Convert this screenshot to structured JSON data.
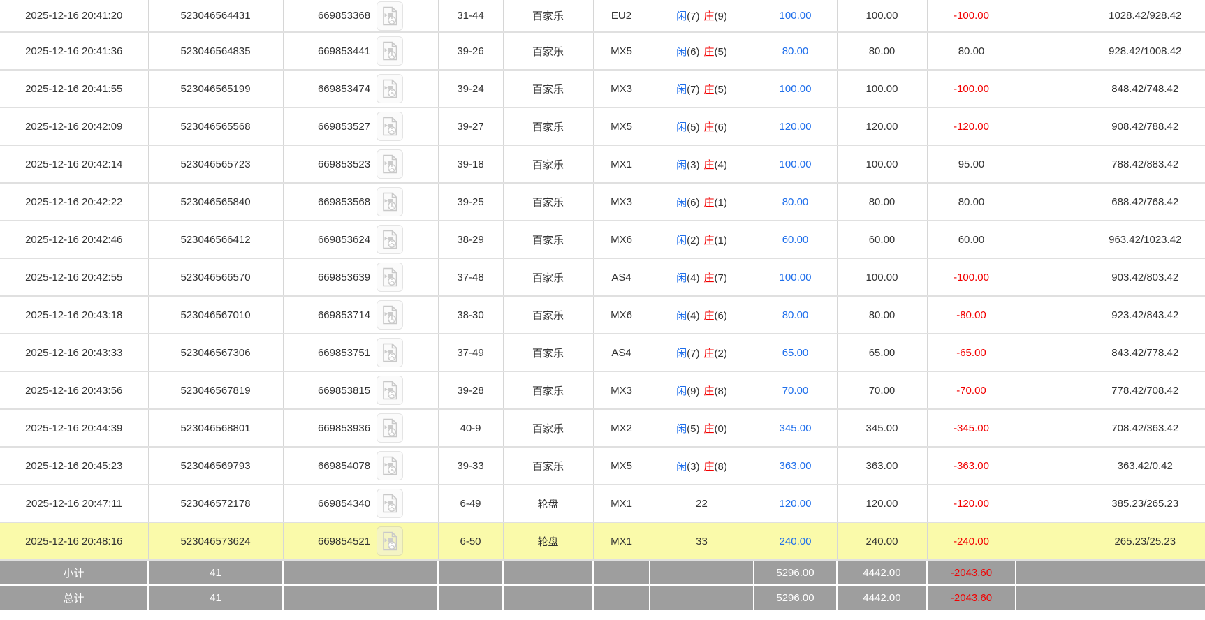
{
  "colors": {
    "bet_link_blue": "#1e6eeb",
    "player_blue": "#1e6eeb",
    "banker_red": "#f20000",
    "loss_red": "#f20000",
    "highlight_yellow": "#fafaaa",
    "summary_gray_bg": "#9e9e9e",
    "body_text": "#333333",
    "summary_text": "#ffffff"
  },
  "icons": {
    "video_replay": "video-replay-icon"
  },
  "table": {
    "rows": [
      {
        "time": "2025-12-16 20:41:20",
        "serial": "523046564431",
        "round": "669853368",
        "shoe": "31-44",
        "game": "百家乐",
        "table_code": "EU2",
        "result": {
          "kind": "baccarat",
          "player_label": "闲",
          "player_score": "(7)",
          "banker_label": "庄",
          "banker_score": "(9)"
        },
        "bet": "100.00",
        "valid": "100.00",
        "win_loss": "-100.00",
        "balance": "1028.42/928.42",
        "highlight": false
      },
      {
        "time": "2025-12-16 20:41:36",
        "serial": "523046564835",
        "round": "669853441",
        "shoe": "39-26",
        "game": "百家乐",
        "table_code": "MX5",
        "result": {
          "kind": "baccarat",
          "player_label": "闲",
          "player_score": "(6)",
          "banker_label": "庄",
          "banker_score": "(5)"
        },
        "bet": "80.00",
        "valid": "80.00",
        "win_loss": "80.00",
        "balance": "928.42/1008.42",
        "highlight": false
      },
      {
        "time": "2025-12-16 20:41:55",
        "serial": "523046565199",
        "round": "669853474",
        "shoe": "39-24",
        "game": "百家乐",
        "table_code": "MX3",
        "result": {
          "kind": "baccarat",
          "player_label": "闲",
          "player_score": "(7)",
          "banker_label": "庄",
          "banker_score": "(5)"
        },
        "bet": "100.00",
        "valid": "100.00",
        "win_loss": "-100.00",
        "balance": "848.42/748.42",
        "highlight": false
      },
      {
        "time": "2025-12-16 20:42:09",
        "serial": "523046565568",
        "round": "669853527",
        "shoe": "39-27",
        "game": "百家乐",
        "table_code": "MX5",
        "result": {
          "kind": "baccarat",
          "player_label": "闲",
          "player_score": "(5)",
          "banker_label": "庄",
          "banker_score": "(6)"
        },
        "bet": "120.00",
        "valid": "120.00",
        "win_loss": "-120.00",
        "balance": "908.42/788.42",
        "highlight": false
      },
      {
        "time": "2025-12-16 20:42:14",
        "serial": "523046565723",
        "round": "669853523",
        "shoe": "39-18",
        "game": "百家乐",
        "table_code": "MX1",
        "result": {
          "kind": "baccarat",
          "player_label": "闲",
          "player_score": "(3)",
          "banker_label": "庄",
          "banker_score": "(4)"
        },
        "bet": "100.00",
        "valid": "100.00",
        "win_loss": "95.00",
        "balance": "788.42/883.42",
        "highlight": false
      },
      {
        "time": "2025-12-16 20:42:22",
        "serial": "523046565840",
        "round": "669853568",
        "shoe": "39-25",
        "game": "百家乐",
        "table_code": "MX3",
        "result": {
          "kind": "baccarat",
          "player_label": "闲",
          "player_score": "(6)",
          "banker_label": "庄",
          "banker_score": "(1)"
        },
        "bet": "80.00",
        "valid": "80.00",
        "win_loss": "80.00",
        "balance": "688.42/768.42",
        "highlight": false
      },
      {
        "time": "2025-12-16 20:42:46",
        "serial": "523046566412",
        "round": "669853624",
        "shoe": "38-29",
        "game": "百家乐",
        "table_code": "MX6",
        "result": {
          "kind": "baccarat",
          "player_label": "闲",
          "player_score": "(2)",
          "banker_label": "庄",
          "banker_score": "(1)"
        },
        "bet": "60.00",
        "valid": "60.00",
        "win_loss": "60.00",
        "balance": "963.42/1023.42",
        "highlight": false
      },
      {
        "time": "2025-12-16 20:42:55",
        "serial": "523046566570",
        "round": "669853639",
        "shoe": "37-48",
        "game": "百家乐",
        "table_code": "AS4",
        "result": {
          "kind": "baccarat",
          "player_label": "闲",
          "player_score": "(4)",
          "banker_label": "庄",
          "banker_score": "(7)"
        },
        "bet": "100.00",
        "valid": "100.00",
        "win_loss": "-100.00",
        "balance": "903.42/803.42",
        "highlight": false
      },
      {
        "time": "2025-12-16 20:43:18",
        "serial": "523046567010",
        "round": "669853714",
        "shoe": "38-30",
        "game": "百家乐",
        "table_code": "MX6",
        "result": {
          "kind": "baccarat",
          "player_label": "闲",
          "player_score": "(4)",
          "banker_label": "庄",
          "banker_score": "(6)"
        },
        "bet": "80.00",
        "valid": "80.00",
        "win_loss": "-80.00",
        "balance": "923.42/843.42",
        "highlight": false
      },
      {
        "time": "2025-12-16 20:43:33",
        "serial": "523046567306",
        "round": "669853751",
        "shoe": "37-49",
        "game": "百家乐",
        "table_code": "AS4",
        "result": {
          "kind": "baccarat",
          "player_label": "闲",
          "player_score": "(7)",
          "banker_label": "庄",
          "banker_score": "(2)"
        },
        "bet": "65.00",
        "valid": "65.00",
        "win_loss": "-65.00",
        "balance": "843.42/778.42",
        "highlight": false
      },
      {
        "time": "2025-12-16 20:43:56",
        "serial": "523046567819",
        "round": "669853815",
        "shoe": "39-28",
        "game": "百家乐",
        "table_code": "MX3",
        "result": {
          "kind": "baccarat",
          "player_label": "闲",
          "player_score": "(9)",
          "banker_label": "庄",
          "banker_score": "(8)"
        },
        "bet": "70.00",
        "valid": "70.00",
        "win_loss": "-70.00",
        "balance": "778.42/708.42",
        "highlight": false
      },
      {
        "time": "2025-12-16 20:44:39",
        "serial": "523046568801",
        "round": "669853936",
        "shoe": "40-9",
        "game": "百家乐",
        "table_code": "MX2",
        "result": {
          "kind": "baccarat",
          "player_label": "闲",
          "player_score": "(5)",
          "banker_label": "庄",
          "banker_score": "(0)"
        },
        "bet": "345.00",
        "valid": "345.00",
        "win_loss": "-345.00",
        "balance": "708.42/363.42",
        "highlight": false
      },
      {
        "time": "2025-12-16 20:45:23",
        "serial": "523046569793",
        "round": "669854078",
        "shoe": "39-33",
        "game": "百家乐",
        "table_code": "MX5",
        "result": {
          "kind": "baccarat",
          "player_label": "闲",
          "player_score": "(3)",
          "banker_label": "庄",
          "banker_score": "(8)"
        },
        "bet": "363.00",
        "valid": "363.00",
        "win_loss": "-363.00",
        "balance": "363.42/0.42",
        "highlight": false
      },
      {
        "time": "2025-12-16 20:47:11",
        "serial": "523046572178",
        "round": "669854340",
        "shoe": "6-49",
        "game": "轮盘",
        "table_code": "MX1",
        "result": {
          "kind": "plain",
          "text": "22"
        },
        "bet": "120.00",
        "valid": "120.00",
        "win_loss": "-120.00",
        "balance": "385.23/265.23",
        "highlight": false
      },
      {
        "time": "2025-12-16 20:48:16",
        "serial": "523046573624",
        "round": "669854521",
        "shoe": "6-50",
        "game": "轮盘",
        "table_code": "MX1",
        "result": {
          "kind": "plain",
          "text": "33"
        },
        "bet": "240.00",
        "valid": "240.00",
        "win_loss": "-240.00",
        "balance": "265.23/25.23",
        "highlight": true
      }
    ],
    "summary": [
      {
        "label": "小计",
        "count": "41",
        "bet": "5296.00",
        "valid": "4442.00",
        "win_loss": "-2043.60"
      },
      {
        "label": "总计",
        "count": "41",
        "bet": "5296.00",
        "valid": "4442.00",
        "win_loss": "-2043.60"
      }
    ]
  }
}
